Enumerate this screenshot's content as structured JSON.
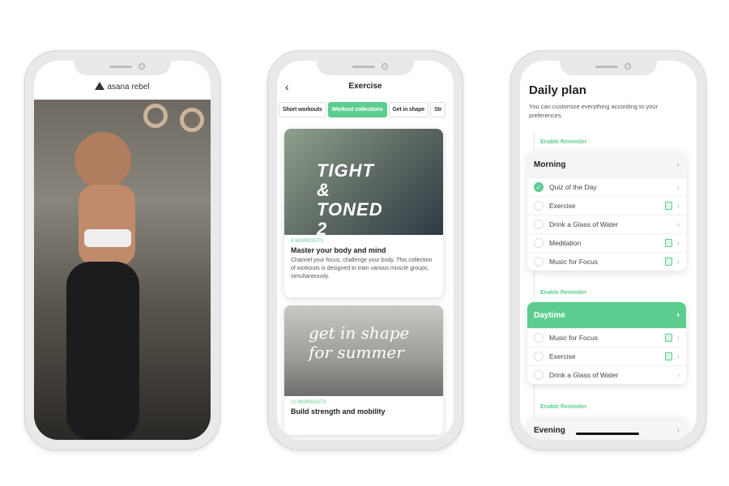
{
  "phone1": {
    "brand": "asana rebel"
  },
  "phone2": {
    "title": "Exercise",
    "tabs": [
      {
        "label": "Short workouts",
        "active": false
      },
      {
        "label": "Workout collections",
        "active": true
      },
      {
        "label": "Get in shape",
        "active": false
      },
      {
        "label": "Str",
        "active": false
      }
    ],
    "cards": [
      {
        "image_text": "TIGHT & TONED 2",
        "count": "8 WORKOUTS",
        "title": "Master your body and mind",
        "description": "Channel your focus, challenge your body. This collection of workouts is designed to train various muscle groups, simultaneously."
      },
      {
        "image_text": "get in shape for summer",
        "count": "10 WORKOUTS",
        "title": "Build strength and mobility"
      }
    ]
  },
  "phone3": {
    "title": "Daily plan",
    "subtitle": "You can customize everything according to your preferences.",
    "reminder_label": "Enable Reminder",
    "sections": [
      {
        "name": "Morning",
        "active": false,
        "items": [
          {
            "label": "Quiz of the Day",
            "done": true,
            "badge": false
          },
          {
            "label": "Exercise",
            "done": false,
            "badge": true
          },
          {
            "label": "Drink a Glass of Water",
            "done": false,
            "badge": false
          },
          {
            "label": "Meditation",
            "done": false,
            "badge": true
          },
          {
            "label": "Music for Focus",
            "done": false,
            "badge": true
          }
        ]
      },
      {
        "name": "Daytime",
        "active": true,
        "items": [
          {
            "label": "Music for Focus",
            "done": false,
            "badge": true
          },
          {
            "label": "Exercise",
            "done": false,
            "badge": true
          },
          {
            "label": "Drink a Glass of Water",
            "done": false,
            "badge": false
          }
        ]
      },
      {
        "name": "Evening",
        "active": false,
        "items": []
      }
    ]
  },
  "colors": {
    "accent": "#5ccd8f"
  }
}
